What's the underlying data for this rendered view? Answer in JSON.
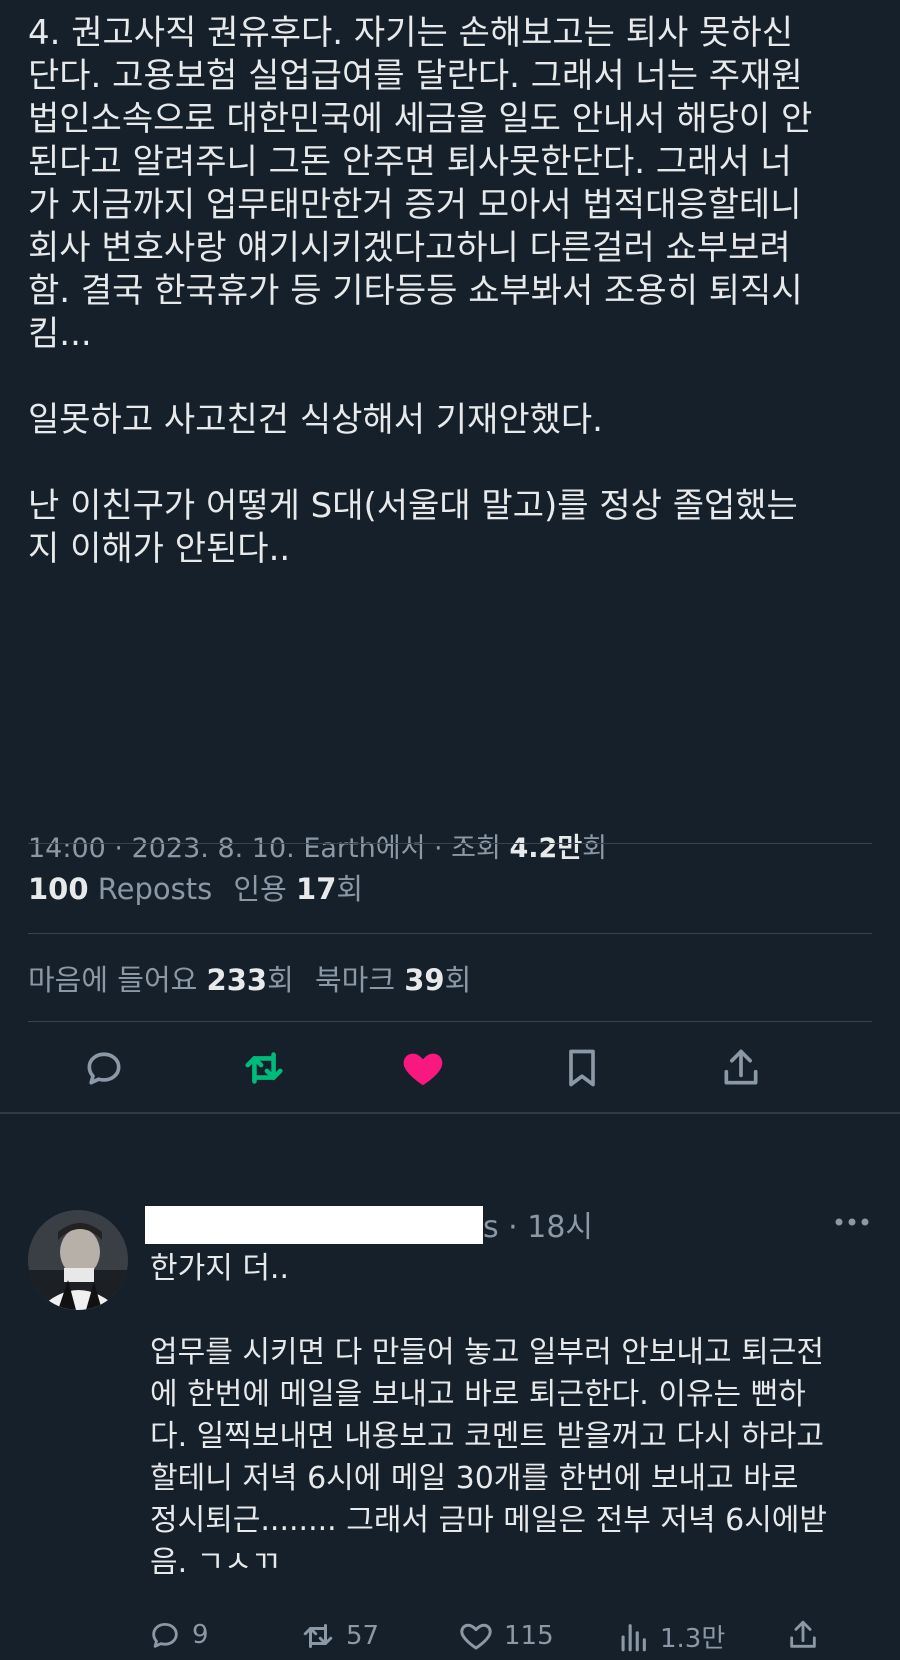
{
  "tweet": {
    "lines": [
      "4. 권고사직 권유후다. 자기는 손해보고는 퇴사 못하신",
      "단다. 고용보험 실업급여를 달란다. 그래서 너는 주재원",
      "법인소속으로 대한민국에 세금을 일도 안내서 해당이 안",
      "된다고 알려주니 그돈 안주면 퇴사못한단다. 그래서 너",
      "가 지금까지 업무태만한거 증거 모아서 법적대응할테니",
      "회사 변호사랑 얘기시키겠다고하니 다른걸러 쇼부보려",
      "함. 결국 한국휴가 등 기타등등 쇼부봐서 조용히 퇴직시",
      "킴...",
      "",
      "일못하고 사고친건 식상해서 기재안했다.",
      "",
      "난 이친구가 어떻게 S대(서울대 말고)를 정상 졸업했는",
      "지 이해가 안된다.."
    ],
    "meta": {
      "time": "14:00",
      "date": "2023. 8. 10.",
      "source": "Earth에서",
      "views_label": "조회",
      "views_value": "4.2만",
      "views_unit": "회",
      "sep": " · "
    },
    "stats": {
      "reposts_value": "100",
      "reposts_label": "Reposts",
      "quotes_label": "인용",
      "quotes_value": "17",
      "quotes_unit": "회",
      "likes_label": "마음에 들어요",
      "likes_value": "233",
      "likes_unit": "회",
      "bookmarks_label": "북마크",
      "bookmarks_value": "39",
      "bookmarks_unit": "회"
    },
    "actions": {
      "reply_icon": "reply-icon",
      "repost_icon": "repost-icon",
      "like_icon": "heart-icon",
      "bookmark_icon": "bookmark-icon",
      "share_icon": "share-icon"
    }
  },
  "reply": {
    "handle_suffix": "s",
    "time": "18시",
    "sep": " · ",
    "lines": [
      "한가지 더..",
      "",
      "업무를 시키면 다 만들어 놓고 일부러 안보내고 퇴근전",
      "에 한번에 메일을 보내고 바로 퇴근한다. 이유는 뻔하",
      "다. 일찍보내면 내용보고 코멘트 받을꺼고 다시 하라고",
      "할테니 저녁 6시에 메일 30개를 한번에 보내고 바로",
      "정시퇴근........ 그래서 금마 메일은 전부 저녁 6시에받",
      "음. ㄱㅅㄲ"
    ],
    "reply_count": "9",
    "repost_count": "57",
    "like_count": "115",
    "view_count": "1.3만"
  },
  "colors": {
    "background": "#15202b",
    "text": "#e7e9ea",
    "muted": "#8b98a5",
    "repost_active": "#00ba7c",
    "like_active": "#f91880"
  }
}
